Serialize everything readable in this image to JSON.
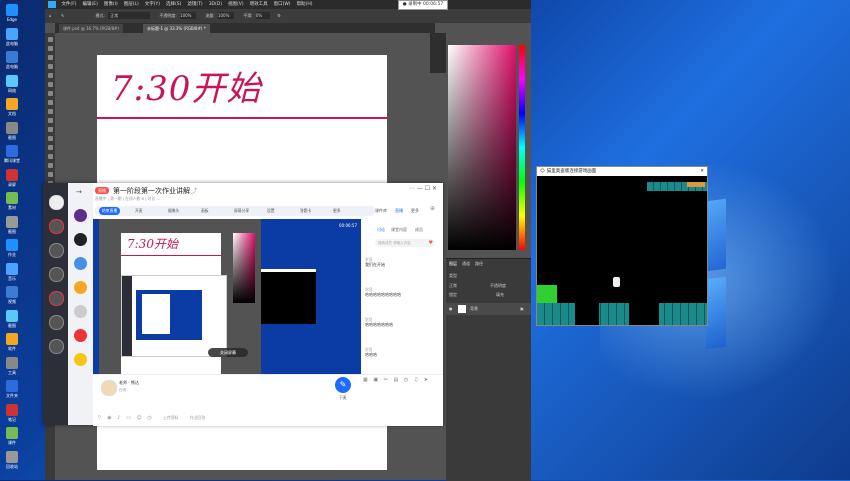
{
  "desktop": {
    "icons": [
      "Edge",
      "此电脑",
      "此电脑",
      "网络",
      "文档",
      "截图",
      "腾讯课堂",
      "录屏",
      "素材",
      "截图",
      "作业",
      "音乐",
      "视频",
      "截图",
      "软件",
      "工具",
      "文件夹",
      "笔记",
      "课件",
      "回收站"
    ]
  },
  "recorder": {
    "label": "● 录制中 00:06:57"
  },
  "photoshop": {
    "menu": [
      "文件(F)",
      "编辑(E)",
      "图像(I)",
      "图层(L)",
      "文字(Y)",
      "选择(S)",
      "滤镜(T)",
      "3D(D)",
      "视图(V)",
      "增效工具",
      "窗口(W)",
      "帮助(H)"
    ],
    "options": {
      "mode_label": "模式:",
      "mode_value": "正常",
      "opacity_label": "不透明度:",
      "opacity_value": "100%",
      "flow_label": "流量:",
      "flow_value": "100%",
      "smooth_label": "平滑:",
      "smooth_value": "0%"
    },
    "tabs": [
      "课件.psd @ 16.7% (RGB/8#)",
      "未标题-1 @ 33.3% (RGB/8#) *"
    ],
    "canvas_text": "7:30开始",
    "panels": {
      "layers_tab": "图层",
      "channels_tab": "通道",
      "paths_tab": "路径",
      "kind": "类型",
      "normal": "正常",
      "opacity": "不透明度",
      "lock": "锁定",
      "fill": "填充",
      "layer_name": "背景"
    },
    "accent": "#d0105a"
  },
  "game": {
    "title": "猫里奥盗版连接游戏画面"
  },
  "classroom": {
    "title": "第一阶段第一次作业讲解",
    "subtitle": "直播中 | 第一期 | 在线人数 8 | 时长 …",
    "live_badge": "直播",
    "tools": [
      "结束直播",
      "开麦",
      "摄像头",
      "画板",
      "屏幕分享",
      "设置",
      "答题卡",
      "更多"
    ],
    "header_tabs": [
      "课件库",
      "直播",
      "更多"
    ],
    "chat_tabs": [
      "讨论",
      "课堂内容",
      "成员"
    ],
    "chat_search": "搜索成员 请输入内容",
    "messages": [
      {
        "name": "学员",
        "text": "我们在开始"
      },
      {
        "name": "学员",
        "text": "哈哈哈哈哈哈哈哈哈"
      },
      {
        "name": "学员",
        "text": "哈哈哈哈哈哈哈"
      },
      {
        "name": "学员",
        "text": "哈哈哈"
      }
    ],
    "video_timer": "00:06:57",
    "video_overlay": "关闭屏幕",
    "inner_canvas_text": "7:30开始",
    "teacher": {
      "name": "老师 · 熊达",
      "status": "在线"
    },
    "bottom_icons": [
      "上传资料",
      "作业回答"
    ],
    "mic_label": "下麦"
  }
}
